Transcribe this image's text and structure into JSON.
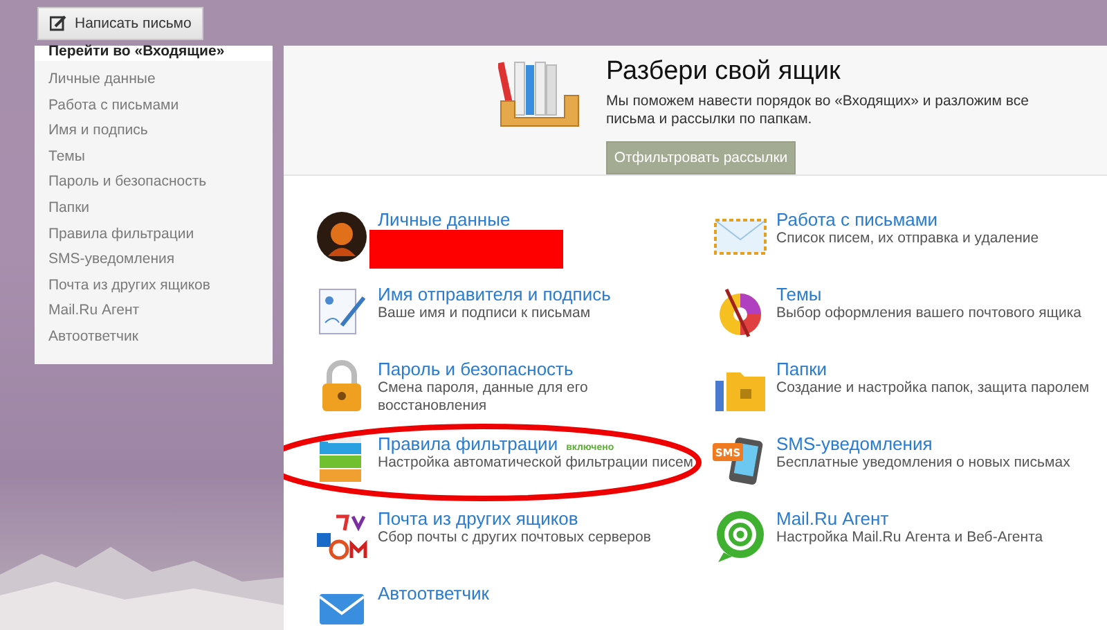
{
  "compose_button": {
    "label": "Написать письмо"
  },
  "sidebar": {
    "inbox_link": "Перейти во «Входящие»",
    "items": [
      {
        "label": "Личные данные"
      },
      {
        "label": "Работа с письмами"
      },
      {
        "label": "Имя и подпись"
      },
      {
        "label": "Темы"
      },
      {
        "label": "Пароль и безопасность"
      },
      {
        "label": "Папки"
      },
      {
        "label": "Правила фильтрации"
      },
      {
        "label": "SMS-уведомления"
      },
      {
        "label": "Почта из других ящиков"
      },
      {
        "label": "Mail.Ru Агент"
      },
      {
        "label": "Автоответчик"
      }
    ]
  },
  "promo": {
    "title": "Разбери свой ящик",
    "text": "Мы поможем навести порядок во «Входящих» и разложим все письма и рассылки по папкам.",
    "button": "Отфильтровать рассылки"
  },
  "settings": [
    {
      "kind": "avatar",
      "title": "Личные данные",
      "redacted": true
    },
    {
      "kind": "envelope",
      "title": "Работа с письмами",
      "description": "Список писем, их отправка и удаление"
    },
    {
      "kind": "signature",
      "title": "Имя отправителя и подпись",
      "description": "Ваше имя и подписи к письмам"
    },
    {
      "kind": "palette",
      "title": "Темы",
      "description": "Выбор оформления вашего почтового ящика"
    },
    {
      "kind": "lock",
      "title": "Пароль и безопасность",
      "description": "Смена пароля, данные для его восстановления"
    },
    {
      "kind": "folder",
      "title": "Папки",
      "description": "Создание и настройка папок, защита паролем"
    },
    {
      "kind": "filter",
      "title": "Правила фильтрации",
      "badge": "включено",
      "description": "Настройка автоматической фильтрации писем",
      "circled": true
    },
    {
      "kind": "sms",
      "icon_label": "SMS",
      "title": "SMS-уведомления",
      "description": "Бесплатные уведомления о новых письмах"
    },
    {
      "kind": "mailboxes",
      "title": "Почта из других ящиков",
      "description": "Сбор почты с других почтовых серверов"
    },
    {
      "kind": "agent",
      "title": "Mail.Ru Агент",
      "description": "Настройка Mail.Ru Агента и Веб-Агента"
    },
    {
      "kind": "autoreply",
      "title": "Автоответчик"
    }
  ]
}
